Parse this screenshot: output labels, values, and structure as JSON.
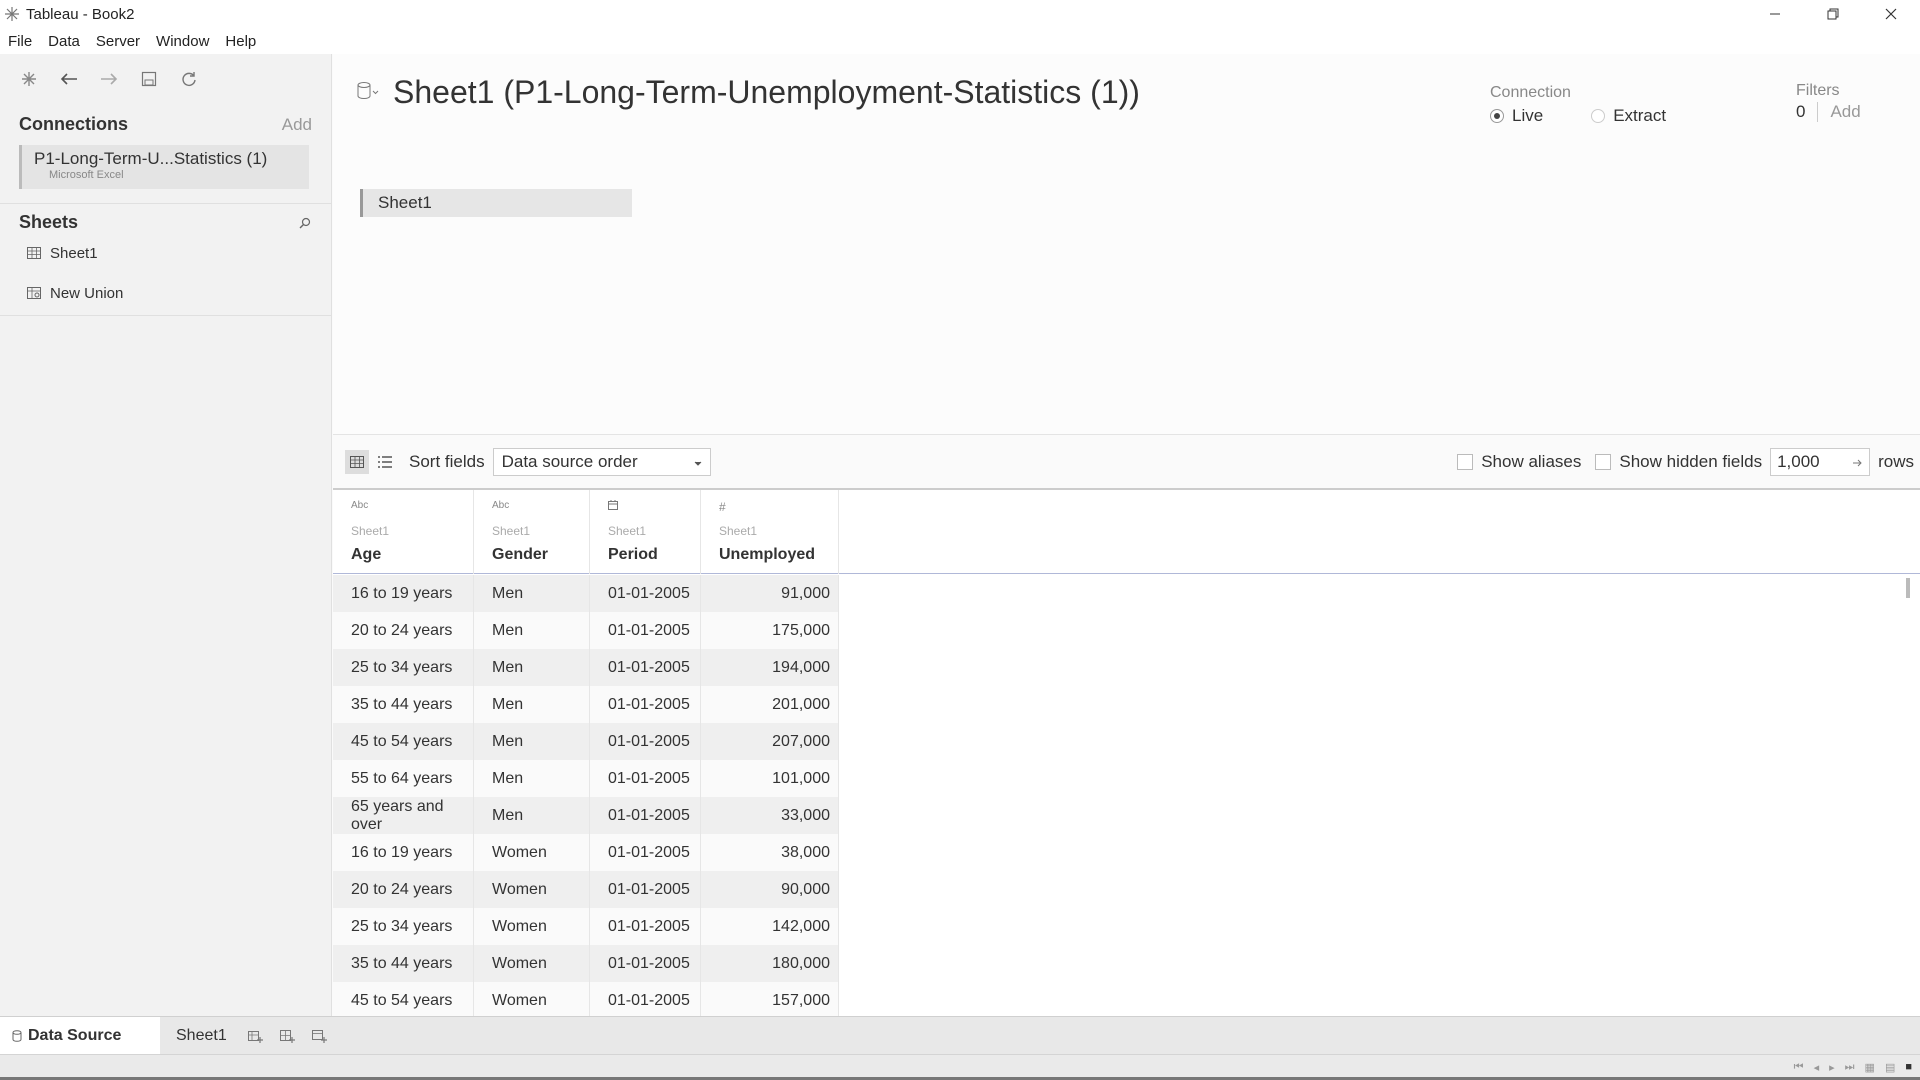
{
  "window": {
    "title": "Tableau - Book2",
    "app_icon": "tableau-logo-icon"
  },
  "menu": [
    "File",
    "Data",
    "Server",
    "Window",
    "Help"
  ],
  "left_panel": {
    "connections_title": "Connections",
    "connections_add": "Add",
    "connection": {
      "name": "P1-Long-Term-U...Statistics (1)",
      "type": "Microsoft Excel"
    },
    "sheets_title": "Sheets",
    "sheets": [
      "Sheet1"
    ],
    "new_union": "New Union"
  },
  "canvas": {
    "title": "Sheet1 (P1-Long-Term-Unemployment-Statistics (1))",
    "connection_label": "Connection",
    "live_label": "Live",
    "extract_label": "Extract",
    "selected_connection": "Live",
    "filters_label": "Filters",
    "filters_count": "0",
    "filters_add": "Add",
    "table_pill": "Sheet1"
  },
  "grid_toolbar": {
    "sort_label": "Sort fields",
    "sort_value": "Data source order",
    "show_aliases": "Show aliases",
    "show_hidden": "Show hidden fields",
    "rows_value": "1,000",
    "rows_label": "rows"
  },
  "grid": {
    "columns": [
      {
        "type": "Abc",
        "source": "Sheet1",
        "name": "Age"
      },
      {
        "type": "Abc",
        "source": "Sheet1",
        "name": "Gender"
      },
      {
        "type": "date-icon",
        "source": "Sheet1",
        "name": "Period"
      },
      {
        "type": "#",
        "source": "Sheet1",
        "name": "Unemployed"
      }
    ],
    "rows": [
      [
        "16 to 19 years",
        "Men",
        "01-01-2005",
        "91,000"
      ],
      [
        "20 to 24 years",
        "Men",
        "01-01-2005",
        "175,000"
      ],
      [
        "25 to 34 years",
        "Men",
        "01-01-2005",
        "194,000"
      ],
      [
        "35 to 44 years",
        "Men",
        "01-01-2005",
        "201,000"
      ],
      [
        "45 to 54 years",
        "Men",
        "01-01-2005",
        "207,000"
      ],
      [
        "55 to 64 years",
        "Men",
        "01-01-2005",
        "101,000"
      ],
      [
        "65 years and over",
        "Men",
        "01-01-2005",
        "33,000"
      ],
      [
        "16 to 19 years",
        "Women",
        "01-01-2005",
        "38,000"
      ],
      [
        "20 to 24 years",
        "Women",
        "01-01-2005",
        "90,000"
      ],
      [
        "25 to 34 years",
        "Women",
        "01-01-2005",
        "142,000"
      ],
      [
        "35 to 44 years",
        "Women",
        "01-01-2005",
        "180,000"
      ],
      [
        "45 to 54 years",
        "Women",
        "01-01-2005",
        "157,000"
      ]
    ]
  },
  "bottom_tabs": {
    "data_source": "Data Source",
    "sheet": "Sheet1"
  }
}
